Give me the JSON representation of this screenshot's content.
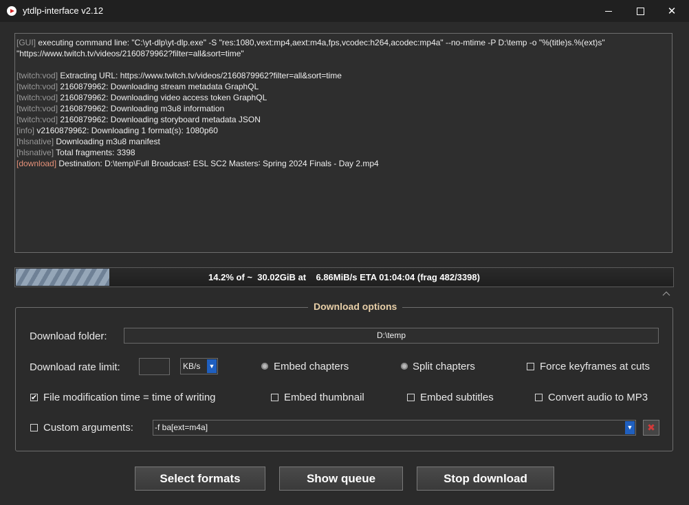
{
  "window": {
    "title": "ytdlp-interface v2.12"
  },
  "log": {
    "gui_tag": "[GUI]",
    "gui_text": " executing command line: \"C:\\yt-dlp\\yt-dlp.exe\" -S \"res:1080,vext:mp4,aext:m4a,fps,vcodec:h264,acodec:mp4a\" --no-mtime  -P D:\\temp -o \"%(title)s.%(ext)s\" \"https://www.twitch.tv/videos/2160879962?filter=all&sort=time\"",
    "lines": [
      {
        "tag": "[twitch:vod]",
        "text": " Extracting URL: https://www.twitch.tv/videos/2160879962?filter=all&sort=time"
      },
      {
        "tag": "[twitch:vod]",
        "text": " 2160879962: Downloading stream metadata GraphQL"
      },
      {
        "tag": "[twitch:vod]",
        "text": " 2160879962: Downloading video access token GraphQL"
      },
      {
        "tag": "[twitch:vod]",
        "text": " 2160879962: Downloading m3u8 information"
      },
      {
        "tag": "[twitch:vod]",
        "text": " 2160879962: Downloading storyboard metadata JSON"
      },
      {
        "tag": "[info]",
        "text": " v2160879962: Downloading 1 format(s): 1080p60"
      },
      {
        "tag": "[hlsnative]",
        "text": " Downloading m3u8 manifest"
      },
      {
        "tag": "[hlsnative]",
        "text": " Total fragments: 3398"
      },
      {
        "tag": "[download]",
        "text": " Destination: D:\\temp\\Full Broadcast∶ ESL SC2 Masters∶ Spring 2024 Finals - Day 2.mp4"
      }
    ]
  },
  "progress": {
    "percent": 14.2,
    "text": "14.2% of ~  30.02GiB at    6.86MiB/s ETA 01:04:04 (frag 482/3398)"
  },
  "options": {
    "legend": "Download options",
    "folder_label": "Download folder:",
    "folder_value": "D:\\temp",
    "rate_label": "Download rate limit:",
    "rate_value": "",
    "rate_unit": "KB/s",
    "embed_chapters": "Embed chapters",
    "split_chapters": "Split chapters",
    "force_keyframes": "Force keyframes at cuts",
    "file_mtime": "File modification time = time of writing",
    "file_mtime_checked": true,
    "embed_thumbnail": "Embed thumbnail",
    "embed_subtitles": "Embed subtitles",
    "convert_mp3": "Convert audio to MP3",
    "custom_args_label": "Custom arguments:",
    "custom_args_value": "-f ba[ext=m4a]",
    "check_mark": "✔",
    "clear_glyph": "✖"
  },
  "buttons": {
    "select_formats": "Select formats",
    "show_queue": "Show queue",
    "stop_download": "Stop download"
  },
  "colors": {
    "accent_blue": "#1f5fbf",
    "download_tag": "#e6927a",
    "legend": "#e8cfa8"
  }
}
